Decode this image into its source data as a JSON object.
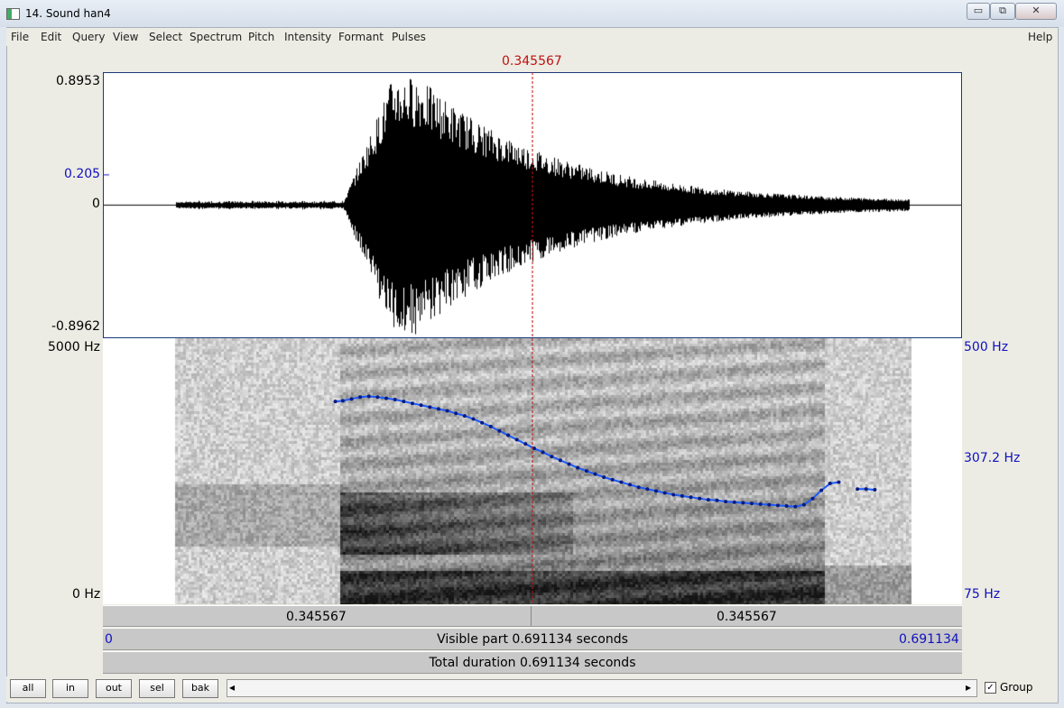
{
  "window": {
    "title": "14. Sound han4",
    "minimize": "▭",
    "maximize": "⧉",
    "close": "✕"
  },
  "menu": {
    "items": [
      "File",
      "Edit",
      "Query",
      "View",
      "Select",
      "Spectrum",
      "Pitch",
      "Intensity",
      "Formant",
      "Pulses"
    ],
    "help": "Help"
  },
  "cursor": {
    "time_label": "0.345567",
    "time": 0.345567
  },
  "waveform": {
    "max_label": "0.8953",
    "mid_label": "0.205",
    "zero_label": "0",
    "min_label": "-0.8962",
    "range": [
      -0.8962,
      0.8953
    ],
    "marker": 0.205
  },
  "spectrogram": {
    "top_label": "5000 Hz",
    "bottom_label": "0 Hz",
    "pitch_top_label": "500 Hz",
    "pitch_mid_label": "307.2 Hz",
    "pitch_bottom_label": "75 Hz",
    "pitch_range_hz": [
      75,
      500
    ]
  },
  "pitch_track": {
    "segments": [
      {
        "t": [
          0.187,
          0.193,
          0.2,
          0.207,
          0.214,
          0.221,
          0.228,
          0.235,
          0.242,
          0.249,
          0.256,
          0.263,
          0.27,
          0.277,
          0.284,
          0.291,
          0.298,
          0.305,
          0.312,
          0.319,
          0.326,
          0.333,
          0.34,
          0.347,
          0.354,
          0.361,
          0.368,
          0.375,
          0.382,
          0.389,
          0.396,
          0.403,
          0.41,
          0.417,
          0.424,
          0.431,
          0.438,
          0.445,
          0.452,
          0.459,
          0.466,
          0.473,
          0.48,
          0.487,
          0.494,
          0.501,
          0.508,
          0.515,
          0.522,
          0.529,
          0.536,
          0.543,
          0.55,
          0.557,
          0.564,
          0.571,
          0.578,
          0.585,
          0.592
        ],
        "f0": [
          399,
          400,
          403,
          406,
          407,
          406,
          404,
          402,
          399,
          396,
          393,
          390,
          387,
          384,
          380,
          376,
          371,
          365,
          359,
          352,
          345,
          338,
          331,
          324,
          318,
          311,
          305,
          299,
          293,
          288,
          283,
          278,
          274,
          270,
          266,
          262,
          259,
          256,
          253,
          250,
          248,
          246,
          244,
          242,
          241,
          239,
          238,
          237,
          236,
          235,
          234,
          233,
          232,
          231,
          234,
          244,
          257,
          268,
          270
        ]
      },
      {
        "t": [
          0.607,
          0.614,
          0.621
        ],
        "f0": [
          259,
          259,
          258
        ]
      }
    ]
  },
  "time_bar": {
    "left": "0.345567",
    "right": "0.345567"
  },
  "visible_bar": {
    "start": "0",
    "text": "Visible part 0.691134 seconds",
    "end": "0.691134",
    "duration": 0.691134
  },
  "total_bar": {
    "text": "Total duration 0.691134 seconds"
  },
  "buttons": {
    "all": "all",
    "in": "in",
    "out": "out",
    "sel": "sel",
    "bak": "bak"
  },
  "scroll": {
    "left_arrow": "◂",
    "right_arrow": "▸"
  },
  "group": {
    "label": "Group",
    "checked": true,
    "mark": "✓"
  }
}
